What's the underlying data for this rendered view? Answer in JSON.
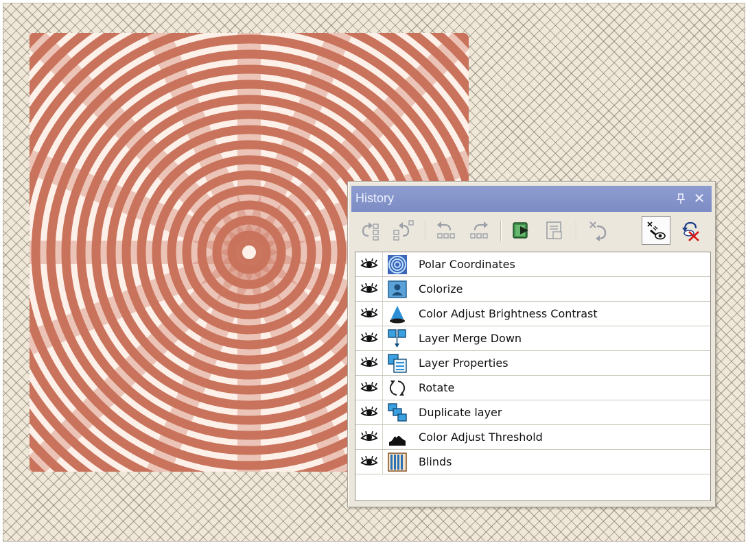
{
  "palette": {
    "title": "History"
  },
  "toolbar": {
    "buttons": [
      {
        "name": "undo-to-here-icon",
        "enabled": false
      },
      {
        "name": "redo-to-here-icon",
        "enabled": false
      },
      {
        "name": "undo-icon",
        "enabled": false
      },
      {
        "name": "redo-icon",
        "enabled": false
      },
      {
        "name": "play-script-icon",
        "enabled": true
      },
      {
        "name": "save-script-icon",
        "enabled": false
      },
      {
        "name": "clear-history-icon",
        "enabled": false
      },
      {
        "name": "toggle-visibility-icon",
        "enabled": true,
        "active": true
      },
      {
        "name": "delete-history-icon",
        "enabled": true
      }
    ]
  },
  "history": {
    "items": [
      {
        "label": "Polar Coordinates",
        "icon": "polar-coordinates-icon"
      },
      {
        "label": "Colorize",
        "icon": "colorize-icon"
      },
      {
        "label": "Color Adjust Brightness Contrast",
        "icon": "brightness-contrast-icon"
      },
      {
        "label": "Layer Merge Down",
        "icon": "layer-merge-down-icon"
      },
      {
        "label": "Layer Properties",
        "icon": "layer-properties-icon"
      },
      {
        "label": "Rotate",
        "icon": "rotate-icon"
      },
      {
        "label": "Duplicate layer",
        "icon": "duplicate-layer-icon"
      },
      {
        "label": "Color Adjust Threshold",
        "icon": "threshold-icon"
      },
      {
        "label": "Blinds",
        "icon": "blinds-icon"
      }
    ]
  },
  "colors": {
    "title_bar": "#8e9dd0",
    "image_rust": "#c9735d",
    "image_light": "#fdf0e8",
    "workspace": "#efe8d8"
  }
}
